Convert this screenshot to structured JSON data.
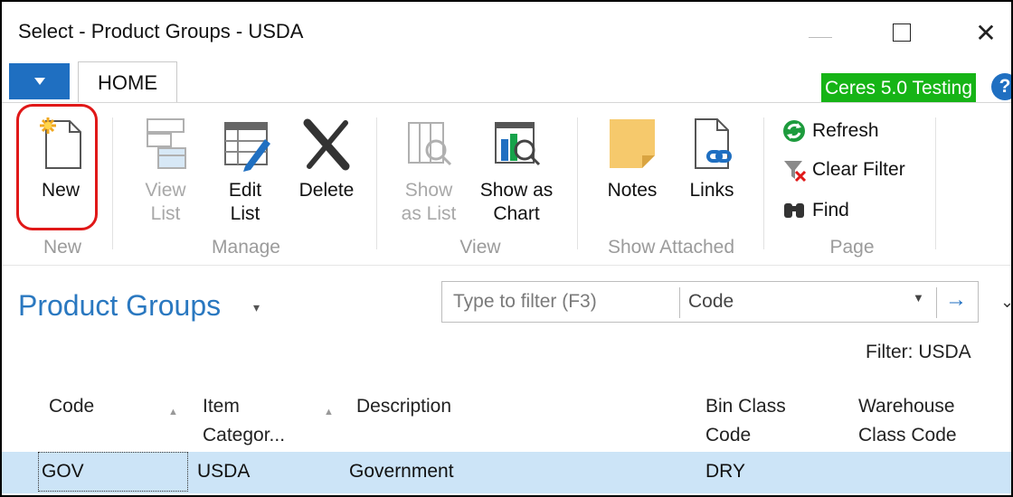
{
  "window": {
    "title": "Select - Product Groups - USDA",
    "controls": [
      "minimize",
      "maximize",
      "close"
    ],
    "close_glyph": "✕"
  },
  "tabs": {
    "app_menu_icon": "dropdown-triangle-icon",
    "home": "HOME"
  },
  "environment_badge": {
    "label": "Ceres 5.0 Testing",
    "color": "#16b416"
  },
  "help_glyph": "?",
  "ribbon": {
    "groups": {
      "new": "New",
      "manage": "Manage",
      "view": "View",
      "show_attached": "Show Attached",
      "page": "Page"
    },
    "buttons": {
      "new": {
        "line1": "New",
        "line2": ""
      },
      "view_list": {
        "line1": "View",
        "line2": "List",
        "disabled": true
      },
      "edit_list": {
        "line1": "Edit",
        "line2": "List"
      },
      "delete": {
        "line1": "Delete",
        "line2": ""
      },
      "show_as_list": {
        "line1": "Show",
        "line2": "as List",
        "disabled": true
      },
      "show_as_chart": {
        "line1": "Show as",
        "line2": "Chart"
      },
      "notes": {
        "line1": "Notes",
        "line2": ""
      },
      "links": {
        "line1": "Links",
        "line2": ""
      },
      "refresh": "Refresh",
      "clear_filter": "Clear Filter",
      "find": "Find"
    }
  },
  "page": {
    "title": "Product Groups",
    "title_caret": "▾",
    "filter": {
      "placeholder": "Type to filter (F3)",
      "field": "Code",
      "dropdown_glyph": "▼",
      "go_glyph": "→"
    },
    "collapse_glyph": "⌄",
    "active_filter": "Filter: USDA"
  },
  "table": {
    "columns": [
      {
        "line1": "Code",
        "line2": "",
        "sortable": true
      },
      {
        "line1": "Item",
        "line2": "Categor...",
        "sortable": true
      },
      {
        "line1": "Description",
        "line2": ""
      },
      {
        "line1": "Bin Class",
        "line2": "Code"
      },
      {
        "line1": "Warehouse",
        "line2": "Class Code"
      }
    ],
    "rows": [
      {
        "code": "GOV",
        "item_category": "USDA",
        "description": "Government",
        "bin_class_code": "DRY",
        "warehouse_class_code": ""
      }
    ],
    "selected_row_color": "#cce4f7"
  },
  "accent_color": "#1f6fc1",
  "highlight_color": "#e01818"
}
